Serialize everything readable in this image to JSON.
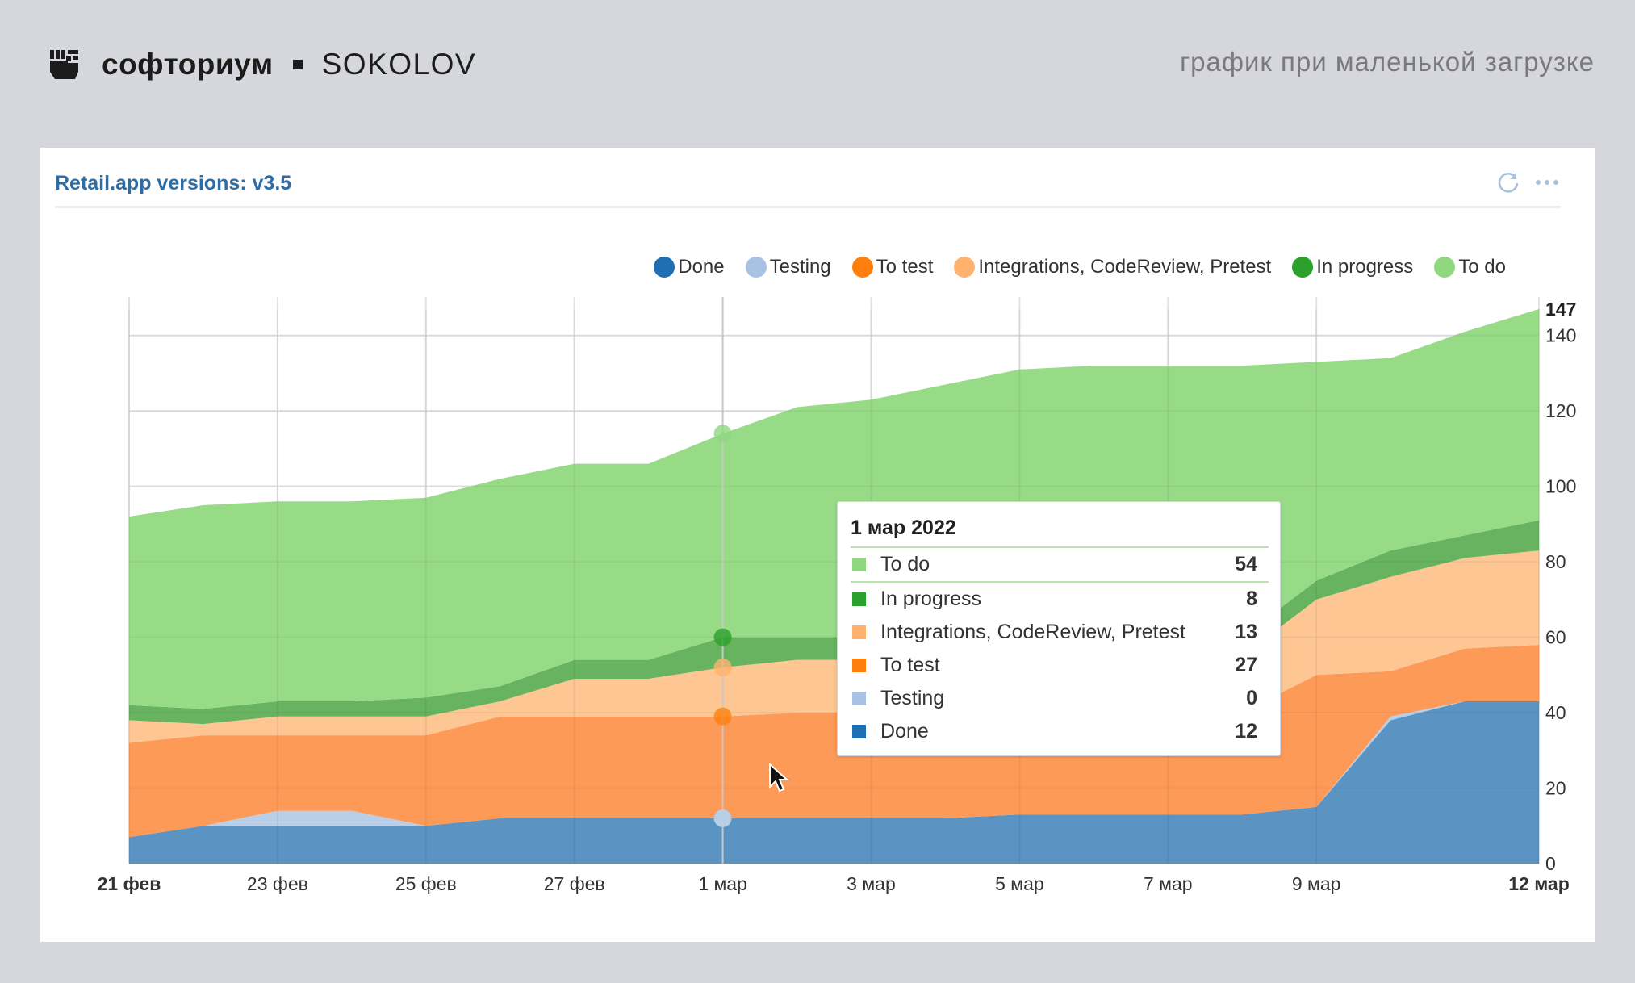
{
  "header": {
    "brand_name": "софториум",
    "brand_partner": "SOKOLOV",
    "caption": "график при маленькой загрузке",
    "logo_icon": "fist-icon"
  },
  "card": {
    "title": "Retail.app versions: v3.5",
    "actions": [
      {
        "name": "refresh",
        "icon": "refresh-icon"
      },
      {
        "name": "more",
        "icon": "more-dots-icon"
      }
    ]
  },
  "colors": {
    "Done": "#1f6fb4",
    "Testing": "#a8c2e6",
    "To test": "#ff7f0e",
    "Integrations, CodeReview, Pretest": "#ffb26e",
    "In progress": "#2ca02c",
    "To do": "#8fd880",
    "title": "#2e6da4"
  },
  "legend": [
    {
      "label": "Done",
      "color": "#1f6fb4"
    },
    {
      "label": "Testing",
      "color": "#a8c2e6"
    },
    {
      "label": "To test",
      "color": "#ff7f0e"
    },
    {
      "label": "Integrations, CodeReview, Pretest",
      "color": "#ffb26e"
    },
    {
      "label": "In progress",
      "color": "#2ca02c"
    },
    {
      "label": "To do",
      "color": "#8fd880"
    }
  ],
  "tooltip": {
    "date": "1 мар 2022",
    "rows": [
      {
        "label": "To do",
        "value": "54",
        "color": "#8fd880"
      },
      {
        "label": "In progress",
        "value": "8",
        "color": "#2ca02c"
      },
      {
        "label": "Integrations, CodeReview, Pretest",
        "value": "13",
        "color": "#ffb26e"
      },
      {
        "label": "To test",
        "value": "27",
        "color": "#ff7f0e"
      },
      {
        "label": "Testing",
        "value": "0",
        "color": "#a8c2e6"
      },
      {
        "label": "Done",
        "value": "12",
        "color": "#1f6fb4"
      }
    ]
  },
  "chart_data": {
    "type": "area",
    "stacked": true,
    "title": "Retail.app versions: v3.5",
    "xlabel": "",
    "ylabel": "",
    "x": [
      "21 фев",
      "22 фев",
      "23 фев",
      "24 фев",
      "25 фев",
      "26 фев",
      "27 фев",
      "28 фев",
      "1 мар",
      "2 мар",
      "3 мар",
      "4 мар",
      "5 мар",
      "6 мар",
      "7 мар",
      "8 мар",
      "9 мар",
      "10 мар",
      "11 мар",
      "12 мар"
    ],
    "x_tick_labels": [
      {
        "index": 0,
        "label": "21 фев",
        "bold": true
      },
      {
        "index": 2,
        "label": "23 фев"
      },
      {
        "index": 4,
        "label": "25 фев"
      },
      {
        "index": 6,
        "label": "27 фев"
      },
      {
        "index": 8,
        "label": "1 мар"
      },
      {
        "index": 10,
        "label": "3 мар"
      },
      {
        "index": 12,
        "label": "5 мар"
      },
      {
        "index": 14,
        "label": "7 мар"
      },
      {
        "index": 16,
        "label": "9 мар"
      },
      {
        "index": 19,
        "label": "12 мар",
        "bold": true
      }
    ],
    "y_ticks": [
      0,
      20,
      40,
      60,
      80,
      100,
      120,
      140
    ],
    "y_max_label": "147",
    "ylim": [
      0,
      147
    ],
    "y_axis_side": "right",
    "grid": true,
    "legend_position": "top-right",
    "series": [
      {
        "name": "Done",
        "values": [
          7,
          10,
          10,
          10,
          10,
          12,
          12,
          12,
          12,
          12,
          12,
          12,
          13,
          13,
          13,
          13,
          15,
          38,
          43,
          43
        ]
      },
      {
        "name": "Testing",
        "values": [
          0,
          0,
          4,
          4,
          0,
          0,
          0,
          0,
          0,
          0,
          0,
          0,
          0,
          0,
          0,
          0,
          0,
          1,
          0,
          0
        ]
      },
      {
        "name": "To test",
        "values": [
          25,
          24,
          20,
          20,
          24,
          27,
          27,
          27,
          27,
          28,
          28,
          28,
          27,
          27,
          27,
          27,
          35,
          12,
          14,
          15
        ]
      },
      {
        "name": "Integrations, CodeReview, Pretest",
        "values": [
          6,
          3,
          5,
          5,
          5,
          4,
          10,
          10,
          13,
          14,
          14,
          14,
          14,
          14,
          15,
          15,
          20,
          25,
          24,
          25
        ]
      },
      {
        "name": "In progress",
        "values": [
          4,
          4,
          4,
          4,
          5,
          4,
          5,
          5,
          8,
          6,
          6,
          5,
          5,
          5,
          5,
          5,
          5,
          7,
          6,
          8
        ]
      },
      {
        "name": "To do",
        "values": [
          50,
          54,
          53,
          53,
          53,
          55,
          52,
          52,
          54,
          61,
          63,
          68,
          72,
          73,
          72,
          72,
          58,
          51,
          54,
          56
        ]
      }
    ],
    "hover_index": 8,
    "annotations": [
      "tooltip at 1 мар 2022"
    ]
  }
}
